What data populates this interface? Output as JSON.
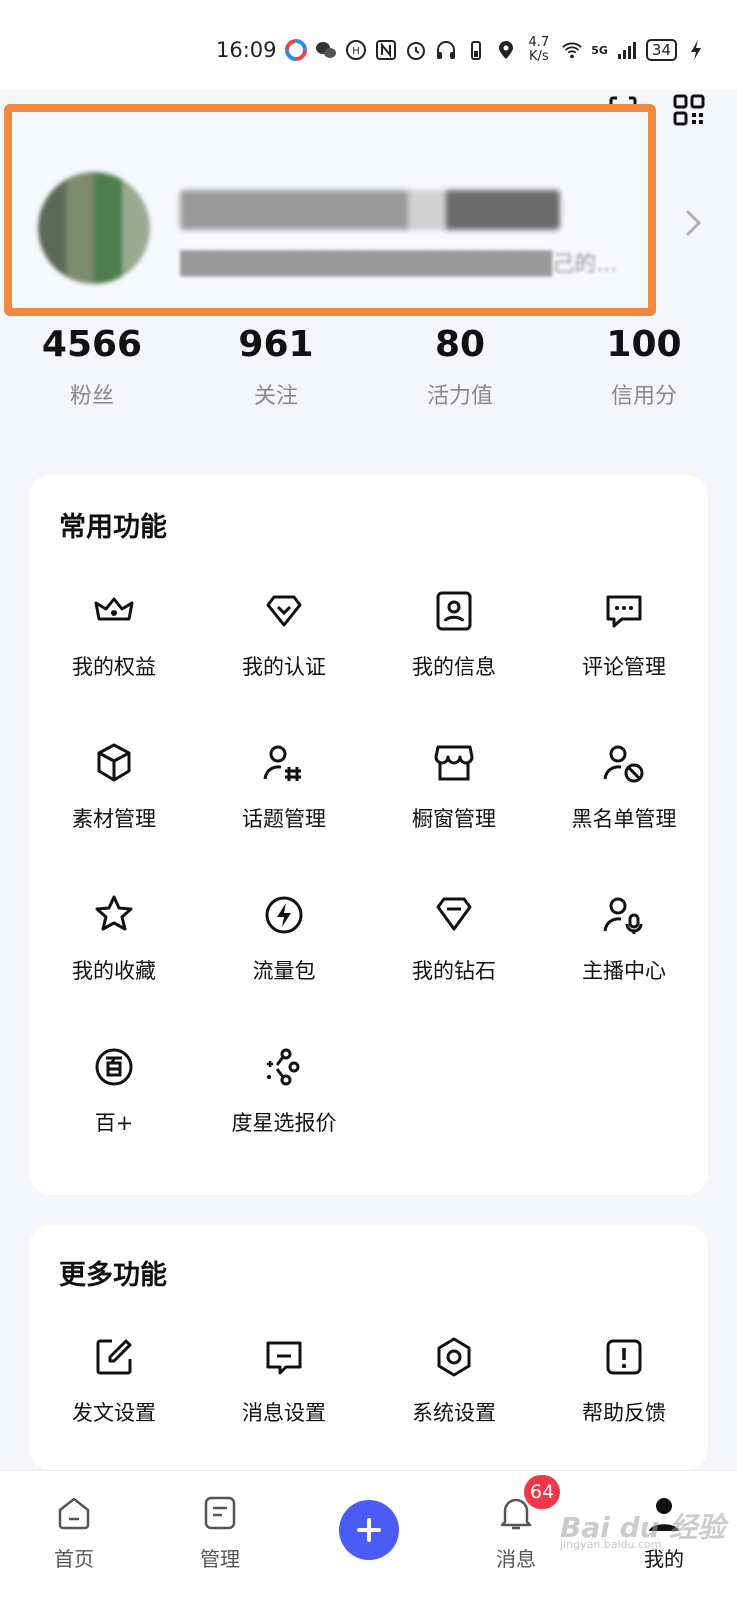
{
  "status_bar": {
    "time": "16:09",
    "speed_value": "4.7",
    "speed_unit": "K/s",
    "network": "5G",
    "battery": "34"
  },
  "profile": {
    "name": "████████",
    "bio": "██████████████████████己的...",
    "highlight_color": "#f0883e"
  },
  "stats": [
    {
      "value": "4566",
      "label": "粉丝"
    },
    {
      "value": "961",
      "label": "关注"
    },
    {
      "value": "80",
      "label": "活力值"
    },
    {
      "value": "100",
      "label": "信用分"
    }
  ],
  "common": {
    "title": "常用功能",
    "items": [
      {
        "label": "我的权益",
        "icon": "crown-icon"
      },
      {
        "label": "我的认证",
        "icon": "badge-check-icon"
      },
      {
        "label": "我的信息",
        "icon": "user-card-icon"
      },
      {
        "label": "评论管理",
        "icon": "comment-icon"
      },
      {
        "label": "素材管理",
        "icon": "cube-icon"
      },
      {
        "label": "话题管理",
        "icon": "user-hash-icon"
      },
      {
        "label": "橱窗管理",
        "icon": "shop-icon"
      },
      {
        "label": "黑名单管理",
        "icon": "user-block-icon"
      },
      {
        "label": "我的收藏",
        "icon": "star-icon"
      },
      {
        "label": "流量包",
        "icon": "lightning-icon"
      },
      {
        "label": "我的钻石",
        "icon": "diamond-icon"
      },
      {
        "label": "主播中心",
        "icon": "user-mic-icon"
      },
      {
        "label": "百+",
        "icon": "bai-plus-icon"
      },
      {
        "label": "度星选报价",
        "icon": "sparkle-icon"
      }
    ]
  },
  "more": {
    "title": "更多功能",
    "items": [
      {
        "label": "发文设置",
        "icon": "edit-icon"
      },
      {
        "label": "消息设置",
        "icon": "message-icon"
      },
      {
        "label": "系统设置",
        "icon": "settings-hex-icon"
      },
      {
        "label": "帮助反馈",
        "icon": "help-icon"
      }
    ]
  },
  "tabbar": {
    "home": "首页",
    "manage": "管理",
    "messages": "消息",
    "messages_badge": "64",
    "me": "我的",
    "accent": "#4a5cf5",
    "badge_color": "#f33548"
  },
  "watermark": {
    "main": "Bai du 经验",
    "sub": "jingyan.baidu.com"
  }
}
